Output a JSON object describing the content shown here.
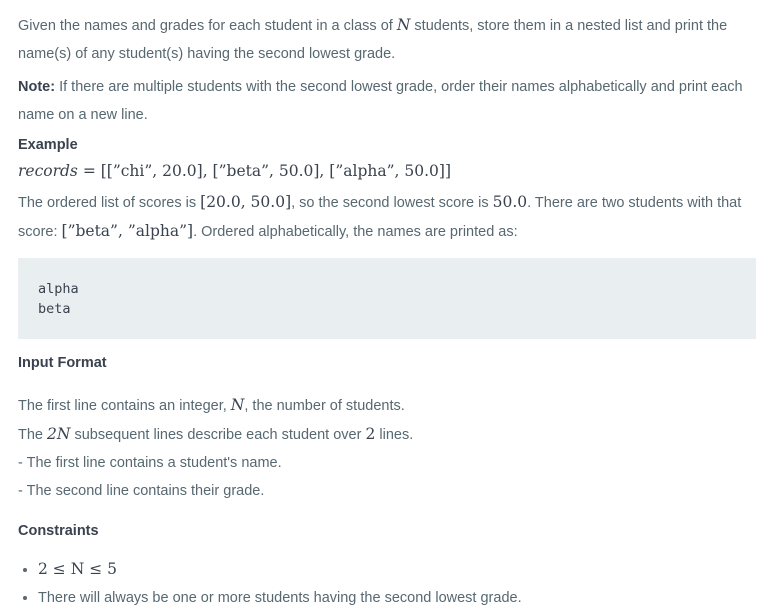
{
  "intro": {
    "before": "Given the names and grades for each student in a class of ",
    "var_n": "N",
    "after": " students, store them in a nested list and print the name(s) of any student(s) having the second lowest grade."
  },
  "note": {
    "label": "Note:",
    "text": " If there are multiple students with the second lowest grade, order their names alphabetically and print each name on a new line."
  },
  "example": {
    "heading": "Example",
    "records_var": "records",
    "records_value": " = [[”chi”, 20.0], [”beta”, 50.0], [”alpha”, 50.0]]",
    "text1": "The ordered list of scores is ",
    "scores": "[20.0, 50.0]",
    "text2": ", so the second lowest score is ",
    "second_score": "50.0",
    "text3": ". There are two students with that score: ",
    "names": "[”beta”, ”alpha”]",
    "text4": ". Ordered alphabetically, the names are printed as:",
    "output": "alpha\nbeta"
  },
  "input_format": {
    "heading": "Input Format",
    "line1_before": "The first line contains an integer, ",
    "line1_var": "N",
    "line1_after": ", the number of students.",
    "line2_before": "The ",
    "line2_var": "2N",
    "line2_mid": " subsequent lines describe each student over ",
    "line2_num": "2",
    "line2_after": " lines.",
    "line3": "- The first line contains a student's name.",
    "line4": "- The second line contains their grade."
  },
  "constraints": {
    "heading": "Constraints",
    "item1": "2 ≤ N ≤ 5",
    "item2": "There will always be one or more students having the second lowest grade."
  }
}
